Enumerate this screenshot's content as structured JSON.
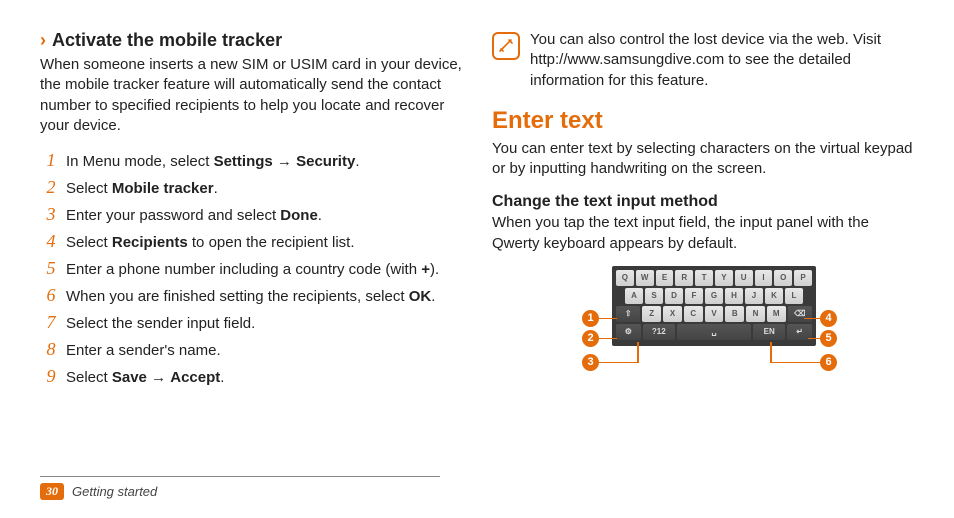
{
  "left": {
    "chevron": "›",
    "title": "Activate the mobile tracker",
    "intro": "When someone inserts a new SIM or USIM card in your device, the mobile tracker feature will automatically send the contact number to specified recipients to help you locate and recover your device.",
    "steps": [
      {
        "n": "1",
        "pre": "In Menu mode, select ",
        "b1": "Settings",
        "mid": " → ",
        "b2": "Security",
        "post": "."
      },
      {
        "n": "2",
        "pre": "Select ",
        "b1": "Mobile tracker",
        "post": "."
      },
      {
        "n": "3",
        "pre": "Enter your password and select ",
        "b1": "Done",
        "post": "."
      },
      {
        "n": "4",
        "pre": "Select ",
        "b1": "Recipients",
        "post": " to open the recipient list."
      },
      {
        "n": "5",
        "pre": "Enter a phone number including a country code (with ",
        "b1": "+",
        "post": ")."
      },
      {
        "n": "6",
        "pre": "When you are finished setting the recipients, select ",
        "b1": "OK",
        "post": "."
      },
      {
        "n": "7",
        "pre": "Select the sender input field."
      },
      {
        "n": "8",
        "pre": "Enter a sender's name."
      },
      {
        "n": "9",
        "pre": "Select ",
        "b1": "Save",
        "mid": " → ",
        "b2": "Accept",
        "post": "."
      }
    ]
  },
  "right": {
    "note": "You can also control the lost device via the web. Visit http://www.samsungdive.com to see the detailed information for this feature.",
    "section": "Enter text",
    "sectionIntro": "You can enter text by selecting characters on the virtual keypad or by inputting handwriting on the screen.",
    "sub": "Change the text input method",
    "subIntro": "When you tap the text input field, the input panel with the Qwerty keyboard appears by default.",
    "kb": {
      "row1": [
        "Q",
        "W",
        "E",
        "R",
        "T",
        "Y",
        "U",
        "I",
        "O",
        "P"
      ],
      "row2": [
        "A",
        "S",
        "D",
        "F",
        "G",
        "H",
        "J",
        "K",
        "L"
      ],
      "row3": [
        "⇧",
        "Z",
        "X",
        "C",
        "V",
        "B",
        "N",
        "M",
        "⌫"
      ],
      "row4": [
        "⚙",
        "?12",
        "␣",
        "EN",
        "↵"
      ]
    },
    "callouts": [
      "1",
      "2",
      "3",
      "4",
      "5",
      "6"
    ]
  },
  "footer": {
    "page": "30",
    "label": "Getting started"
  }
}
